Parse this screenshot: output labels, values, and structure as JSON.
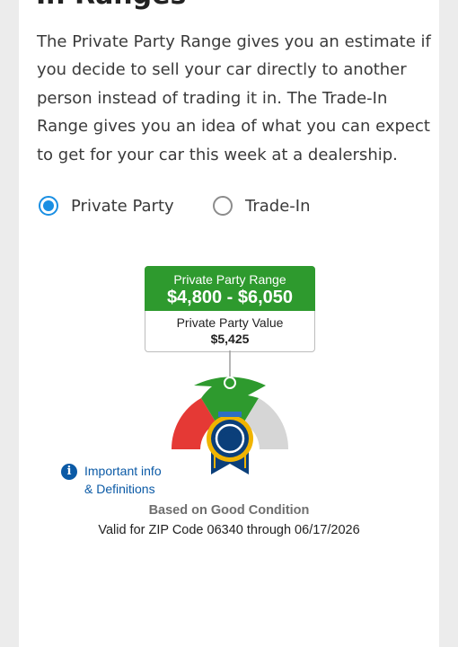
{
  "section": {
    "heading_fragment": "In Ranges",
    "intro": "The Private Party Range gives you an estimate if you decide to sell your car directly to another person instead of trading it in. The Trade-In Range gives you an idea of what you can expect to get for your car this week at a dealership."
  },
  "options": [
    {
      "label": "Private Party",
      "selected": true
    },
    {
      "label": "Trade-In",
      "selected": false
    }
  ],
  "range": {
    "title": "Private Party Range",
    "values": "$4,800 - $6,050",
    "value_title": "Private Party Value",
    "value_amount": "$5,425"
  },
  "gauge": {
    "colors": {
      "low": "#e53935",
      "mid": "#2e9a2e",
      "high": "#d6d6d6",
      "badge": "#0b3f7a",
      "badge_ring": "#f0b400"
    }
  },
  "info": {
    "label_line1": "Important info",
    "label_line2": "& Definitions",
    "icon": "info-icon"
  },
  "footer": {
    "condition": "Based on Good Condition",
    "validity": "Valid for ZIP Code 06340 through 06/17/2026"
  },
  "colors": {
    "accent": "#1a8fe3",
    "range_green": "#2e9a2e",
    "link": "#0b5aa6"
  }
}
